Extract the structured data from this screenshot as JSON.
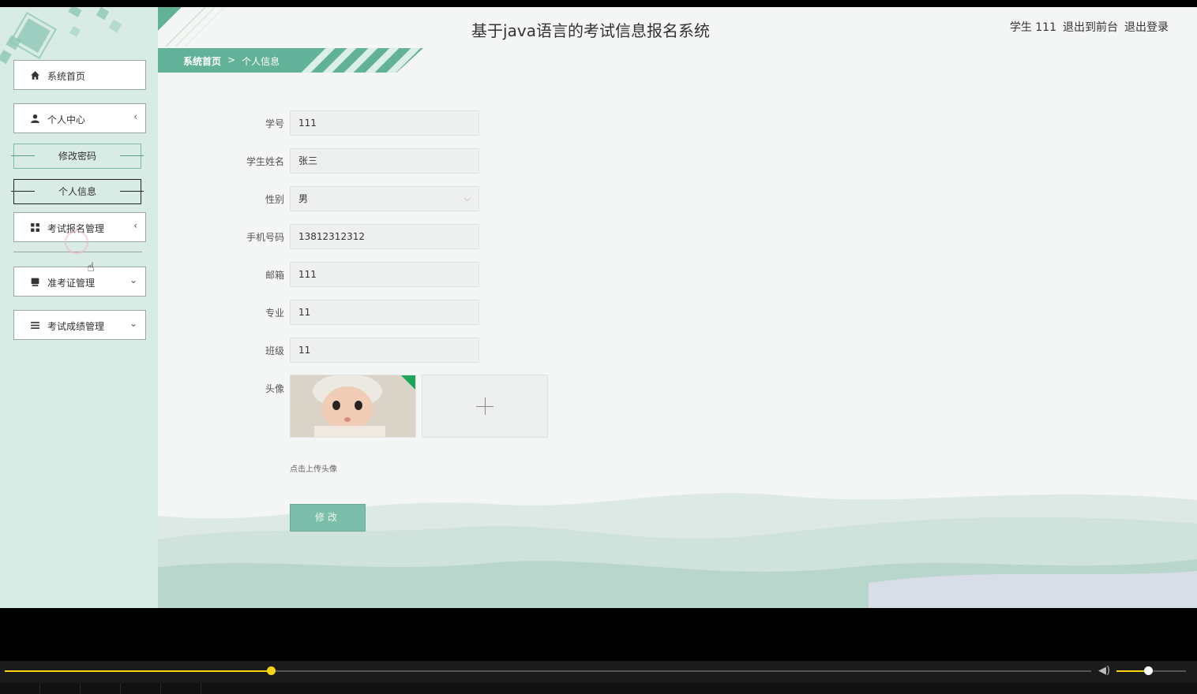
{
  "app": {
    "title": "基于java语言的考试信息报名系统",
    "user_label": "学生 111",
    "front_link": "退出到前台",
    "logout_link": "退出登录"
  },
  "breadcrumb": {
    "home": "系统首页",
    "separator": ">",
    "current": "个人信息"
  },
  "sidebar": {
    "home": "系统首页",
    "personal_center": "个人中心",
    "change_password": "修改密码",
    "personal_info": "个人信息",
    "exam_registration": "考试报名管理",
    "admission_ticket": "准考证管理",
    "exam_scores": "考试成绩管理"
  },
  "form": {
    "student_id_label": "学号",
    "student_id_value": "111",
    "name_label": "学生姓名",
    "name_value": "张三",
    "gender_label": "性别",
    "gender_value": "男",
    "phone_label": "手机号码",
    "phone_value": "13812312312",
    "email_label": "邮箱",
    "email_value": "111",
    "major_label": "专业",
    "major_value": "11",
    "class_label": "班级",
    "class_value": "11",
    "avatar_label": "头像",
    "upload_hint": "点击上传头像",
    "submit_label": "修改"
  },
  "player": {
    "progress": 0.245,
    "volume": 0.45,
    "accent": "#f5d50b"
  },
  "colors": {
    "primary": "#62b199",
    "sidebar_bg": "#d8ebe5",
    "button": "#7bbfaa"
  }
}
